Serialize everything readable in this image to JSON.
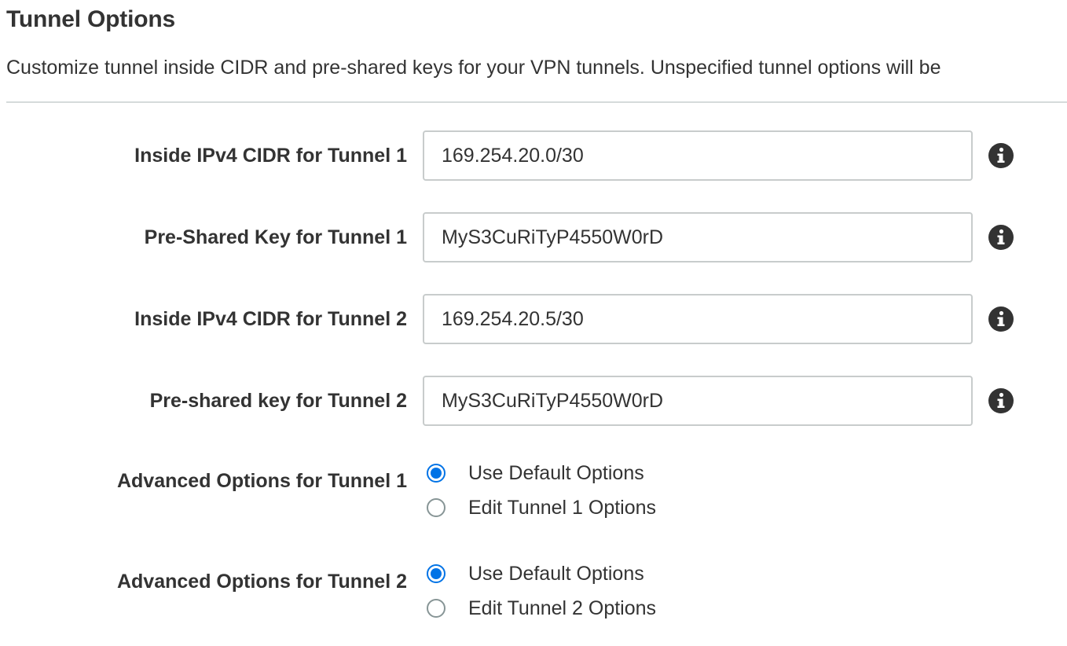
{
  "section": {
    "title": "Tunnel Options",
    "description": "Customize tunnel inside CIDR and pre-shared keys for your VPN tunnels. Unspecified tunnel options will be"
  },
  "fields": {
    "tunnel1_cidr": {
      "label": "Inside IPv4 CIDR for Tunnel 1",
      "value": "169.254.20.0/30",
      "icon": "info-icon"
    },
    "tunnel1_psk": {
      "label": "Pre-Shared Key for Tunnel 1",
      "value": "MyS3CuRiTyP4550W0rD",
      "icon": "info-icon"
    },
    "tunnel2_cidr": {
      "label": "Inside IPv4 CIDR for Tunnel 2",
      "value": "169.254.20.5/30",
      "icon": "info-icon"
    },
    "tunnel2_psk": {
      "label": "Pre-shared key for Tunnel 2",
      "value": "MyS3CuRiTyP4550W0rD",
      "icon": "info-icon"
    }
  },
  "advanced": {
    "tunnel1": {
      "label": "Advanced Options for Tunnel 1",
      "options": [
        "Use Default Options",
        "Edit Tunnel 1 Options"
      ],
      "selected": "Use Default Options"
    },
    "tunnel2": {
      "label": "Advanced Options for Tunnel 2",
      "options": [
        "Use Default Options",
        "Edit Tunnel 2 Options"
      ],
      "selected": "Use Default Options"
    }
  },
  "colors": {
    "accent": "#0073e6",
    "text": "#333333",
    "input_border": "#c8cccc",
    "info_icon": "#333333"
  }
}
